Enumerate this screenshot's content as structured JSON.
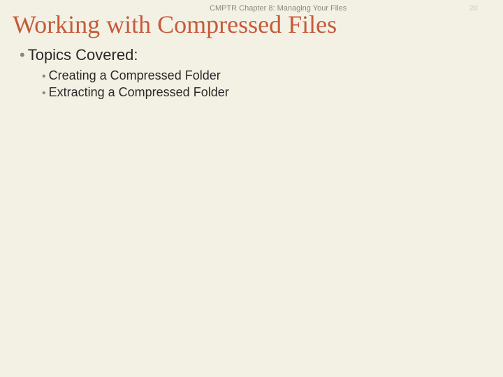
{
  "header": {
    "chapter_text": "CMPTR Chapter 8: Managing Your Files",
    "page_number": "20"
  },
  "title": "Working with Compressed Files",
  "content": {
    "level1": {
      "bullet": "•",
      "text": "Topics Covered:"
    },
    "level2": [
      {
        "bullet": "•",
        "text": "Creating a Compressed Folder"
      },
      {
        "bullet": "•",
        "text": "Extracting a Compressed Folder"
      }
    ]
  }
}
